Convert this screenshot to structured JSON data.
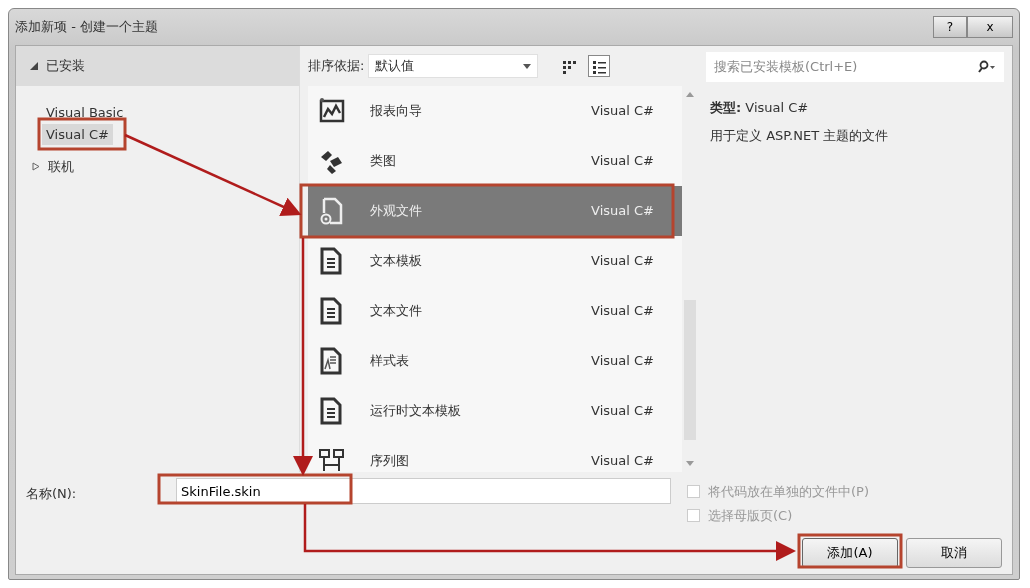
{
  "window": {
    "title": "添加新项 - 创建一个主题"
  },
  "title_buttons": [
    {
      "kind": "help",
      "label": "?"
    },
    {
      "kind": "close",
      "label": "x"
    }
  ],
  "tree": [
    {
      "label": "已安装",
      "expanded": true,
      "children": [
        {
          "label": "Visual Basic",
          "selected": false
        },
        {
          "label": "Visual C#",
          "selected": true
        }
      ]
    },
    {
      "label": "联机",
      "expanded": false
    }
  ],
  "toolbar": {
    "sort_label": "排序依据:",
    "sort_value": "默认值",
    "views": [
      {
        "kind": "grid",
        "selected": false
      },
      {
        "kind": "list",
        "selected": true
      }
    ]
  },
  "search": {
    "placeholder": "搜索已安装模板(Ctrl+E)"
  },
  "templates": [
    {
      "kind": "report",
      "name": "报表向导",
      "language": "Visual C#",
      "selected": false
    },
    {
      "kind": "classdiagram",
      "name": "类图",
      "language": "Visual C#",
      "selected": false
    },
    {
      "kind": "skin",
      "name": "外观文件",
      "language": "Visual C#",
      "selected": true
    },
    {
      "kind": "doc",
      "name": "文本模板",
      "language": "Visual C#",
      "selected": false
    },
    {
      "kind": "doc",
      "name": "文本文件",
      "language": "Visual C#",
      "selected": false
    },
    {
      "kind": "stylesheet",
      "name": "样式表",
      "language": "Visual C#",
      "selected": false
    },
    {
      "kind": "doc",
      "name": "运行时文本模板",
      "language": "Visual C#",
      "selected": false
    },
    {
      "kind": "sequence",
      "name": "序列图",
      "language": "Visual C#",
      "selected": false
    }
  ],
  "details": {
    "type_label": "类型:",
    "type_value": "Visual C#",
    "description": "用于定义 ASP.NET 主题的文件"
  },
  "name_field": {
    "label": "名称(N):",
    "value": "SkinFile.skin"
  },
  "options": [
    {
      "label": "将代码放在单独的文件中(P)",
      "checked": false,
      "disabled": true
    },
    {
      "label": "选择母版页(C)",
      "checked": false,
      "disabled": true
    }
  ],
  "buttons": [
    {
      "label": "添加(A)",
      "kind": "primary"
    },
    {
      "label": "取消",
      "kind": "cancel"
    }
  ]
}
